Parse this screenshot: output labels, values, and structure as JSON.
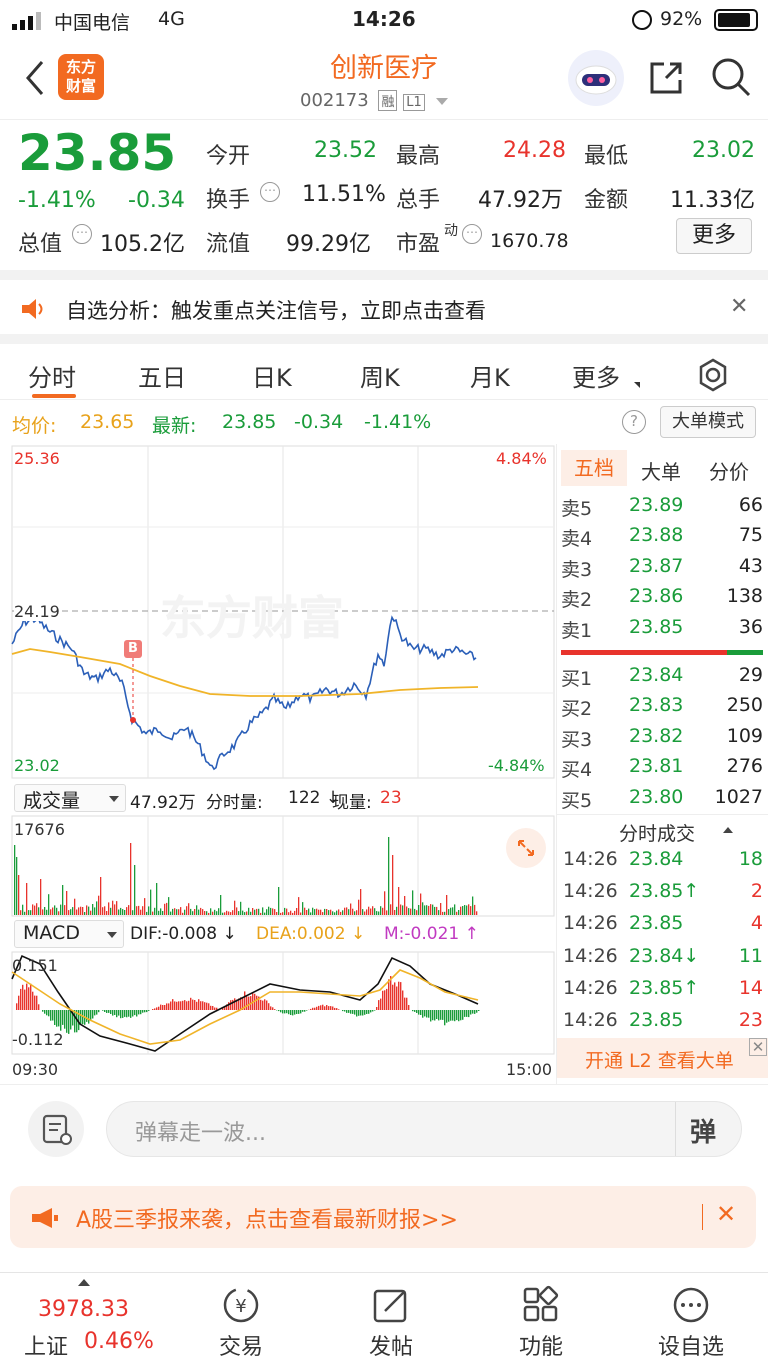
{
  "status_bar": {
    "carrier": "中国电信",
    "network": "4G",
    "time": "14:26",
    "battery": "92%"
  },
  "header": {
    "title": "创新医疗",
    "code": "002173",
    "badge_rong": "融",
    "badge_l1": "L1",
    "logo_text": "东方财富"
  },
  "quote": {
    "price": "23.85",
    "change_pct": "-1.41%",
    "change": "-0.34",
    "open_label": "今开",
    "open": "23.52",
    "high_label": "最高",
    "high": "24.28",
    "low_label": "最低",
    "low": "23.02",
    "turnover_label": "换手",
    "turnover": "11.51%",
    "volume_label": "总手",
    "volume": "47.92万",
    "amount_label": "金额",
    "amount": "11.33亿",
    "mcap_label": "总值",
    "mcap": "105.2亿",
    "float_label": "流值",
    "float": "99.29亿",
    "pe_label": "市盈",
    "pe_sup": "动",
    "pe": "1670.78",
    "more": "更多"
  },
  "notice": {
    "text": "自选分析：触发重点关注信号，立即点击查看"
  },
  "tabs": [
    "分时",
    "五日",
    "日K",
    "周K",
    "月K",
    "更多"
  ],
  "chart_info": {
    "avg_label": "均价:",
    "avg": "23.65",
    "latest_label": "最新:",
    "latest": "23.85",
    "change": "-0.34",
    "pct": "-1.41%",
    "mode_btn": "大单模式"
  },
  "axis": {
    "top_price": "25.36",
    "top_pct": "4.84%",
    "mid_price": "24.19",
    "bottom_price": "23.02",
    "bottom_pct": "-4.84%",
    "start_time": "09:30",
    "end_time": "15:00"
  },
  "volume_bar": {
    "selector": "成交量",
    "total": "47.92万",
    "fenshi_label": "分时量:",
    "fenshi": "122 ↓",
    "now_label": "现量:",
    "now": "23",
    "max": "17676"
  },
  "macd_bar": {
    "selector": "MACD",
    "dif": "DIF:-0.008 ↓",
    "dea": "DEA:0.002 ↓",
    "m": "M:-0.021 ↑",
    "top": "0.151",
    "bottom": "-0.112"
  },
  "marker": "B",
  "order_tabs": [
    "五档",
    "大单",
    "分价"
  ],
  "sell": [
    {
      "label": "卖5",
      "price": "23.89",
      "vol": "66"
    },
    {
      "label": "卖4",
      "price": "23.88",
      "vol": "75"
    },
    {
      "label": "卖3",
      "price": "23.87",
      "vol": "43"
    },
    {
      "label": "卖2",
      "price": "23.86",
      "vol": "138"
    },
    {
      "label": "卖1",
      "price": "23.85",
      "vol": "36"
    }
  ],
  "buy": [
    {
      "label": "买1",
      "price": "23.84",
      "vol": "29"
    },
    {
      "label": "买2",
      "price": "23.83",
      "vol": "250"
    },
    {
      "label": "买3",
      "price": "23.82",
      "vol": "109"
    },
    {
      "label": "买4",
      "price": "23.81",
      "vol": "276"
    },
    {
      "label": "买5",
      "price": "23.80",
      "vol": "1027"
    }
  ],
  "ticks_title": "分时成交",
  "ticks": [
    {
      "time": "14:26",
      "price": "23.84",
      "vol": "18",
      "vcolor": "green"
    },
    {
      "time": "14:26",
      "price": "23.85↑",
      "vol": "2",
      "vcolor": "red"
    },
    {
      "time": "14:26",
      "price": "23.85",
      "vol": "4",
      "vcolor": "red"
    },
    {
      "time": "14:26",
      "price": "23.84↓",
      "vol": "11",
      "vcolor": "green"
    },
    {
      "time": "14:26",
      "price": "23.85↑",
      "vol": "14",
      "vcolor": "red"
    },
    {
      "time": "14:26",
      "price": "23.85",
      "vol": "23",
      "vcolor": "red"
    }
  ],
  "l2_banner": "开通 L2 查看大单",
  "comment": {
    "placeholder": "弹幕走一波...",
    "send": "弹"
  },
  "promo": {
    "text": "A股三季报来袭，点击查看最新财报>>"
  },
  "bottom": {
    "index_value": "3978.33",
    "index_name": "上证",
    "index_pct": "0.46%",
    "items": [
      "交易",
      "发帖",
      "功能",
      "设自选"
    ]
  },
  "colors": {
    "up": "#e8332c",
    "down": "#1a9c3a",
    "accent": "#f26a21",
    "avg_line": "#f0b429",
    "price_line": "#2b5fb8"
  }
}
